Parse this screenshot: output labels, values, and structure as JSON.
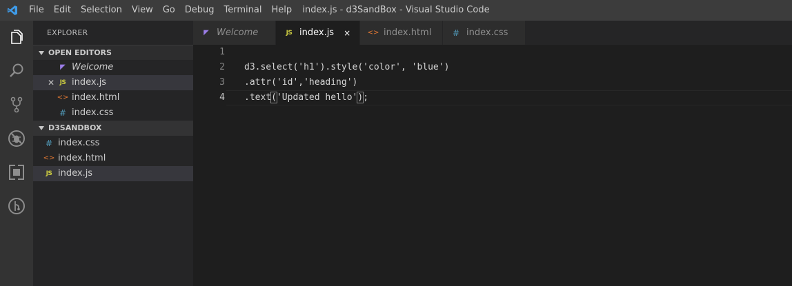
{
  "window": {
    "title": "index.js - d3SandBox - Visual Studio Code"
  },
  "menu": [
    "File",
    "Edit",
    "Selection",
    "View",
    "Go",
    "Debug",
    "Terminal",
    "Help"
  ],
  "activity_bar": [
    "files-icon",
    "search-icon",
    "source-control-icon",
    "debug-icon",
    "extensions-icon",
    "git-graph-icon"
  ],
  "sidebar": {
    "title": "EXPLORER",
    "open_editors_header": "OPEN EDITORS",
    "open_editors": [
      {
        "name": "Welcome",
        "icon": "vscode-icon",
        "glyph": "◤",
        "italic": true
      },
      {
        "name": "index.js",
        "icon": "js-icon",
        "glyph": "JS",
        "close": "✕",
        "selected": true
      },
      {
        "name": "index.html",
        "icon": "html-icon",
        "glyph": "<>"
      },
      {
        "name": "index.css",
        "icon": "css-icon",
        "glyph": "#"
      }
    ],
    "folder_header": "D3SANDBOX",
    "files": [
      {
        "name": "index.css",
        "icon": "css-icon",
        "glyph": "#"
      },
      {
        "name": "index.html",
        "icon": "html-icon",
        "glyph": "<>"
      },
      {
        "name": "index.js",
        "icon": "js-icon",
        "glyph": "JS",
        "selected": true
      }
    ]
  },
  "tabs": [
    {
      "label": "Welcome",
      "glyph": "◤",
      "italic": true
    },
    {
      "label": "index.js",
      "glyph": "JS",
      "active": true,
      "close": "×"
    },
    {
      "label": "index.html",
      "glyph": "<>"
    },
    {
      "label": "index.css",
      "glyph": "#"
    }
  ],
  "editor": {
    "line_numbers": [
      "1",
      "2",
      "3",
      "4"
    ],
    "current_line": 4,
    "lines": [
      "",
      "d3.select('h1').style('color', 'blue')",
      ".attr('id','heading')",
      ".text"
    ],
    "line4_open_paren": "(",
    "line4_string": "'Updated hello'",
    "line4_close_paren": ")",
    "line4_tail": ";"
  },
  "colors": {
    "background": "#1e1e1e",
    "sidebar": "#252526",
    "activity_bar": "#333333",
    "title_bar": "#3c3c3c",
    "js_icon": "#cbcb41",
    "html_icon": "#e37933",
    "css_icon": "#519aba"
  }
}
